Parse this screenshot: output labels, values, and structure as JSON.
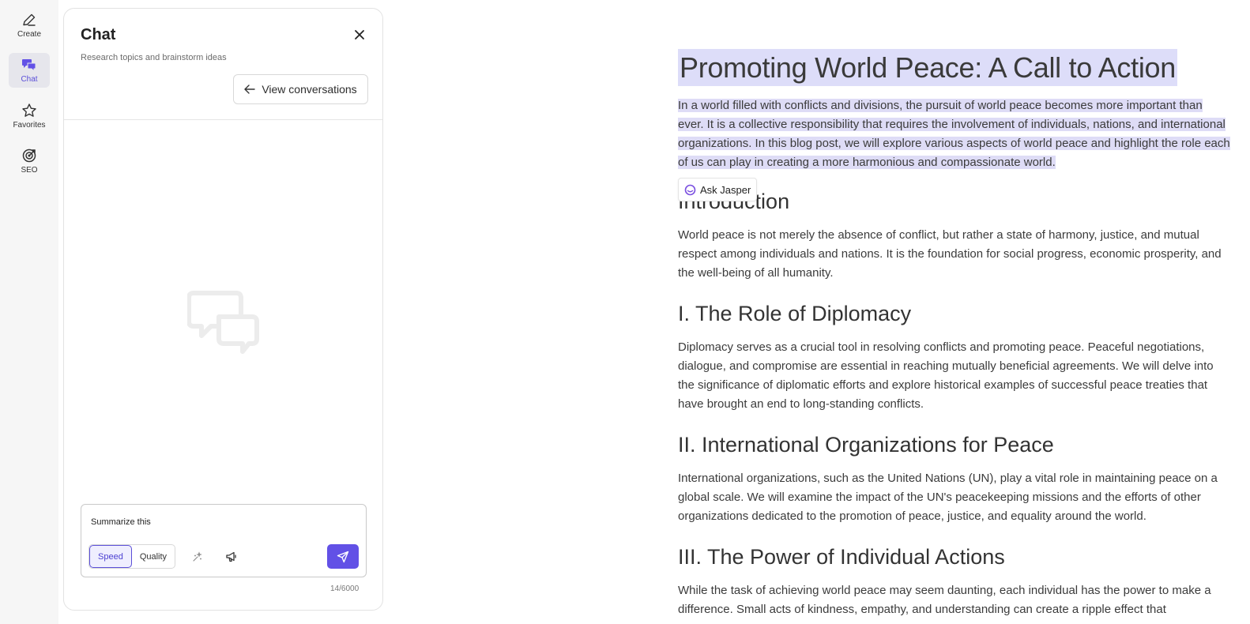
{
  "rail": {
    "items": [
      {
        "label": "Create",
        "icon": "pen-icon"
      },
      {
        "label": "Chat",
        "icon": "chat-icon"
      },
      {
        "label": "Favorites",
        "icon": "star-icon"
      },
      {
        "label": "SEO",
        "icon": "target-icon"
      }
    ],
    "active": "Chat",
    "accent": "#5b4fd8"
  },
  "panel": {
    "title": "Chat",
    "subtitle": "Research topics and brainstorm ideas",
    "view_conversations": "View conversations",
    "input_value": "Summarize this",
    "mode_options": [
      "Speed",
      "Quality"
    ],
    "mode_selected": "Speed",
    "char_counter": "14/6000"
  },
  "document": {
    "title": "Promoting World Peace: A Call to Action",
    "intro": "In a world filled with conflicts and divisions, the pursuit of world peace becomes more important than ever. It is a collective responsibility that requires the involvement of individuals, nations, and international organizations. In this blog post, we will explore various aspects of world peace and highlight the role each of us can play in creating a more harmonious and compassionate world.",
    "ask_jasper": "Ask Jasper",
    "sections": [
      {
        "heading": "Introduction",
        "body": "World peace is not merely the absence of conflict, but rather a state of harmony, justice, and mutual respect among individuals and nations. It is the foundation for social progress, economic prosperity, and the well-being of all humanity."
      },
      {
        "heading": "I. The Role of Diplomacy",
        "body": "Diplomacy serves as a crucial tool in resolving conflicts and promoting peace. Peaceful negotiations, dialogue, and compromise are essential in reaching mutually beneficial agreements. We will delve into the significance of diplomatic efforts and explore historical examples of successful peace treaties that have brought an end to long-standing conflicts."
      },
      {
        "heading": "II. International Organizations for Peace",
        "body": "International organizations, such as the United Nations (UN), play a vital role in maintaining peace on a global scale. We will examine the impact of the UN's peacekeeping missions and the efforts of other organizations dedicated to the promotion of peace, justice, and equality around the world."
      },
      {
        "heading": "III. The Power of Individual Actions",
        "body": "While the task of achieving world peace may seem daunting, each individual has the power to make a difference. Small acts of kindness, empathy, and understanding can create a ripple effect that"
      }
    ],
    "highlight_color": "#ddddf9"
  }
}
